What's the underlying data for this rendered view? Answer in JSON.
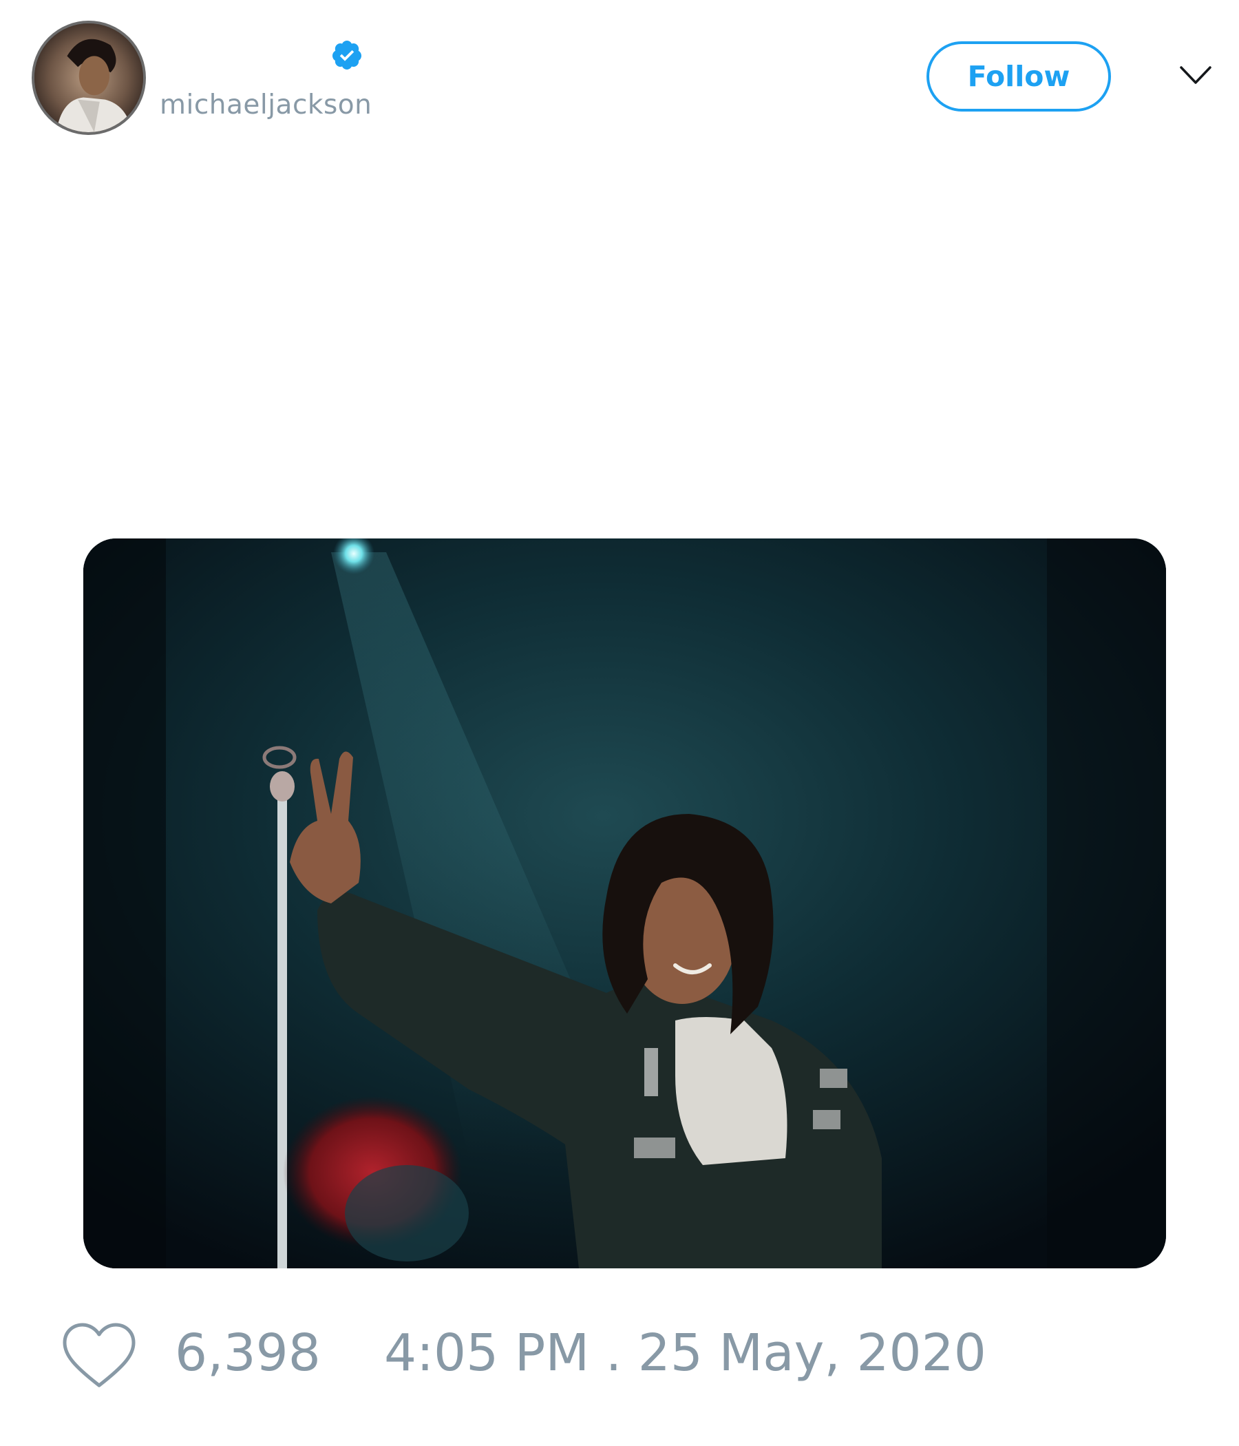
{
  "header": {
    "display_name": "",
    "handle": "michaeljackson",
    "verified": true,
    "follow_label": "Follow"
  },
  "icons": {
    "verified": "verified-badge-icon",
    "menu": "chevron-down-icon",
    "like": "heart-icon"
  },
  "footer": {
    "like_count": "6,398",
    "timestamp": "4:05 PM . 25 May, 2020"
  },
  "colors": {
    "accent": "#1da1f2",
    "muted_text": "#8899a6"
  }
}
